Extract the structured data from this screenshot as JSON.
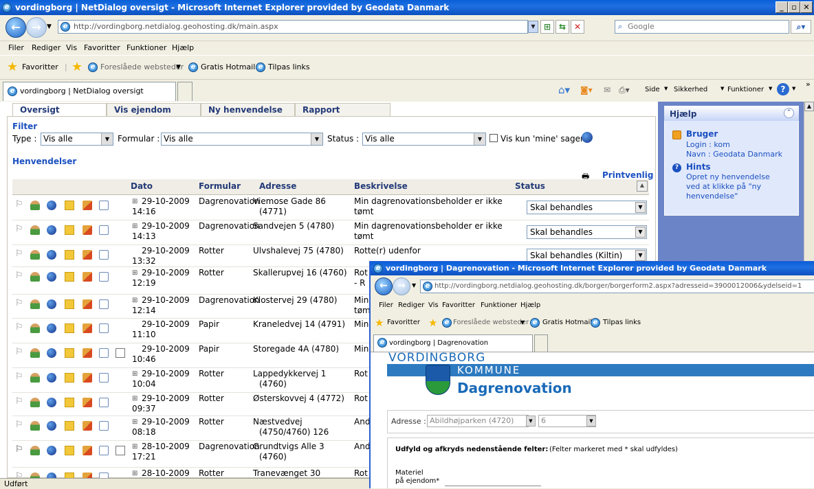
{
  "window": {
    "title": "vordingborg | NetDialog oversigt - Microsoft Internet Explorer provided by Geodata Danmark",
    "url": "http://vordingborg.netdialog.geohosting.dk/main.aspx",
    "search_placeholder": "Google",
    "menu": [
      "Filer",
      "Rediger",
      "Vis",
      "Favoritter",
      "Funktioner",
      "Hjælp"
    ],
    "favorites_label": "Favoritter",
    "fav_links": [
      "Foreslåede websteder",
      "Gratis Hotmail",
      "Tilpas links"
    ],
    "tab_label": "vordingborg | NetDialog oversigt",
    "command_bar": [
      "Side",
      "Sikkerhed",
      "Funktioner"
    ],
    "status_text": "Udført"
  },
  "app": {
    "tabs": [
      "Oversigt",
      "Vis ejendom",
      "Ny henvendelse",
      "Rapport"
    ],
    "filter": {
      "heading": "Filter",
      "type_label": "Type :",
      "type_value": "Vis alle",
      "formular_label": "Formular :",
      "formular_value": "Vis alle",
      "status_label": "Status :",
      "status_value": "Vis alle",
      "mine_label": "Vis kun 'mine' sager"
    },
    "list_heading": "Henvendelser",
    "print_label": "Printvenlig",
    "columns": [
      "Dato",
      "Formular",
      "Adresse",
      "Beskrivelse",
      "Status"
    ],
    "rows": [
      {
        "date": "29-10-2009",
        "time": "14:16",
        "exp": true,
        "form": "Dagrenovation",
        "addr1": "Viemose Gade 86",
        "addr2": "(4771)",
        "desc1": "Min dagrenovationsbeholder er ikke",
        "desc2": "tømt",
        "status": "Skal behandles",
        "doc": false,
        "flag_dark": false
      },
      {
        "date": "29-10-2009",
        "time": "14:13",
        "exp": true,
        "form": "Dagrenovation",
        "addr1": "Sandvejen 5 (4780)",
        "addr2": "",
        "desc1": "Min dagrenovationsbeholder er ikke",
        "desc2": "tømt",
        "status": "Skal behandles",
        "doc": false,
        "flag_dark": false
      },
      {
        "date": "29-10-2009",
        "time": "13:32",
        "exp": false,
        "form": "Rotter",
        "addr1": "Ulvshalevej 75 (4780)",
        "addr2": "",
        "desc1": "Rotte(r) udenfor",
        "desc2": "",
        "status": "Skal behandles (Kiltin)",
        "doc": false,
        "flag_dark": false
      },
      {
        "date": "29-10-2009",
        "time": "12:19",
        "exp": true,
        "form": "Rotter",
        "addr1": "Skallerupvej 16 (4760)",
        "addr2": "",
        "desc1": "Rot",
        "desc2": "- R",
        "status": "",
        "doc": false,
        "flag_dark": false
      },
      {
        "date": "29-10-2009",
        "time": "12:14",
        "exp": true,
        "form": "Dagrenovation",
        "addr1": "Klostervej 29 (4780)",
        "addr2": "",
        "desc1": "Min",
        "desc2": "tøm",
        "status": "",
        "doc": false,
        "flag_dark": false
      },
      {
        "date": "29-10-2009",
        "time": "11:10",
        "exp": false,
        "form": "Papir",
        "addr1": "Kraneledvej 14 (4791)",
        "addr2": "",
        "desc1": "Min",
        "desc2": "",
        "status": "",
        "doc": false,
        "flag_dark": false
      },
      {
        "date": "29-10-2009",
        "time": "10:46",
        "exp": false,
        "form": "Papir",
        "addr1": "Storegade 4A (4780)",
        "addr2": "",
        "desc1": "Min",
        "desc2": "",
        "status": "",
        "doc": true,
        "flag_dark": false
      },
      {
        "date": "29-10-2009",
        "time": "10:04",
        "exp": true,
        "form": "Rotter",
        "addr1": "Lappedykkervej 1",
        "addr2": "(4760)",
        "desc1": "Rot",
        "desc2": "",
        "status": "",
        "doc": false,
        "flag_dark": false
      },
      {
        "date": "29-10-2009",
        "time": "09:37",
        "exp": true,
        "form": "Rotter",
        "addr1": "Østerskovvej 4 (4772)",
        "addr2": "",
        "desc1": "Rot",
        "desc2": "",
        "status": "",
        "doc": false,
        "flag_dark": false
      },
      {
        "date": "29-10-2009",
        "time": "08:18",
        "exp": true,
        "form": "Rotter",
        "addr1": "Næstvedvej",
        "addr2": "(4750/4760) 126",
        "desc1": "And",
        "desc2": "",
        "status": "",
        "doc": false,
        "flag_dark": false
      },
      {
        "date": "28-10-2009",
        "time": "17:21",
        "exp": true,
        "form": "Dagrenovation",
        "addr1": "Grundtvigs Alle 3",
        "addr2": "(4760)",
        "desc1": "And",
        "desc2": "",
        "status": "",
        "doc": true,
        "flag_dark": true
      },
      {
        "date": "28-10-2009",
        "time": "",
        "exp": true,
        "form": "Rotter",
        "addr1": "Tranevænget 30",
        "addr2": "",
        "desc1": "Rot",
        "desc2": "",
        "status": "",
        "doc": false,
        "flag_dark": false
      }
    ]
  },
  "help": {
    "title": "Hjælp",
    "bruger_title": "Bruger",
    "login": "Login : kom",
    "navn": "Navn : Geodata Danmark",
    "hints_title": "Hints",
    "hint1": "Opret ny henvendelse",
    "hint2": "ved at klikke på \"ny",
    "hint3": "henvendelse\""
  },
  "overlay": {
    "title": "vordingborg | Dagrenovation - Microsoft Internet Explorer provided by Geodata Danmark",
    "url": "http://vordingborg.netdialog.geohosting.dk/borger/borgerform2.aspx?adresseid=3900012006&ydelseid=1",
    "menu": [
      "Filer",
      "Rediger",
      "Vis",
      "Favoritter",
      "Funktioner",
      "Hjælp"
    ],
    "favorites_label": "Favoritter",
    "fav_links": [
      "Foreslåede websteder",
      "Gratis Hotmail",
      "Tilpas links"
    ],
    "tab_label": "vordingborg | Dagrenovation",
    "brand_top": "VORDINGBORG",
    "brand_bottom": "KOMMUNE",
    "page_title": "Dagrenovation",
    "adresse_label": "Adresse :",
    "adresse_value": "Abildhøjparken (4720)",
    "number_value": "6",
    "instr_bold": "Udfyld og afkryds nedenstående felter:",
    "instr_rest": "(Felter markeret med * skal udfyldes)",
    "materiel_1": "Materiel",
    "materiel_2": "på ejendom*"
  },
  "colors": {
    "accent": "#1a50c0",
    "titlebar": "#0a5fd8",
    "help_bg": "#6b84c8"
  }
}
